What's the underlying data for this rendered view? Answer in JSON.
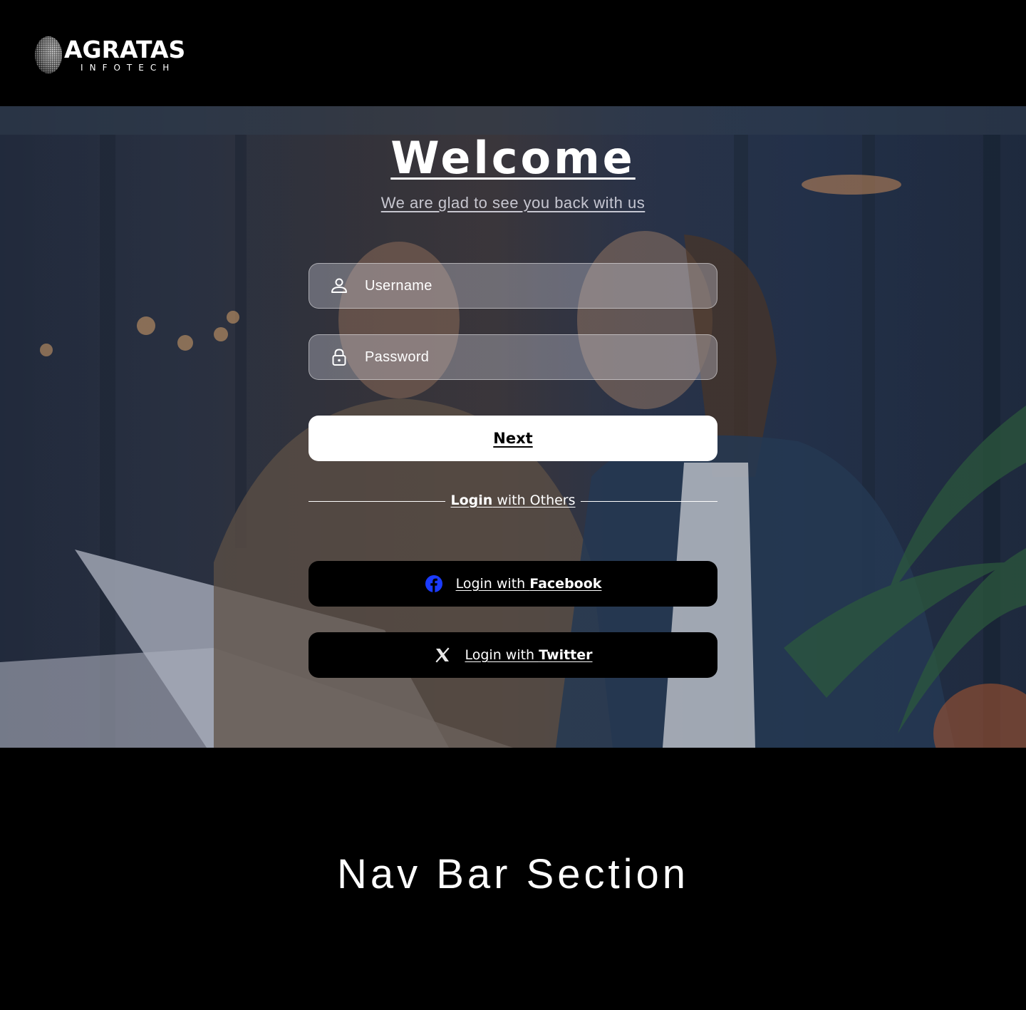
{
  "header": {
    "logo": {
      "main": "AGRATAS",
      "sub": "INFOTECH"
    }
  },
  "hero": {
    "title": "Welcome",
    "subtitle": "We are glad to see you back with us",
    "username": {
      "placeholder": "Username",
      "value": "",
      "icon": "user-icon"
    },
    "password": {
      "placeholder": "Password",
      "value": "",
      "icon": "lock-icon"
    },
    "next_label": "Next",
    "divider": {
      "bold": "Login",
      "rest": " with Others"
    },
    "facebook": {
      "prefix": "Login with ",
      "name": "Facebook",
      "icon": "facebook-icon",
      "color": "#1b3bff"
    },
    "twitter": {
      "prefix": "Login with ",
      "name": "Twitter",
      "icon": "x-icon"
    }
  },
  "footer": {
    "title": "Nav Bar Section"
  },
  "colors": {
    "background": "#000000",
    "button": "#ffffff",
    "social_button": "#000000"
  }
}
